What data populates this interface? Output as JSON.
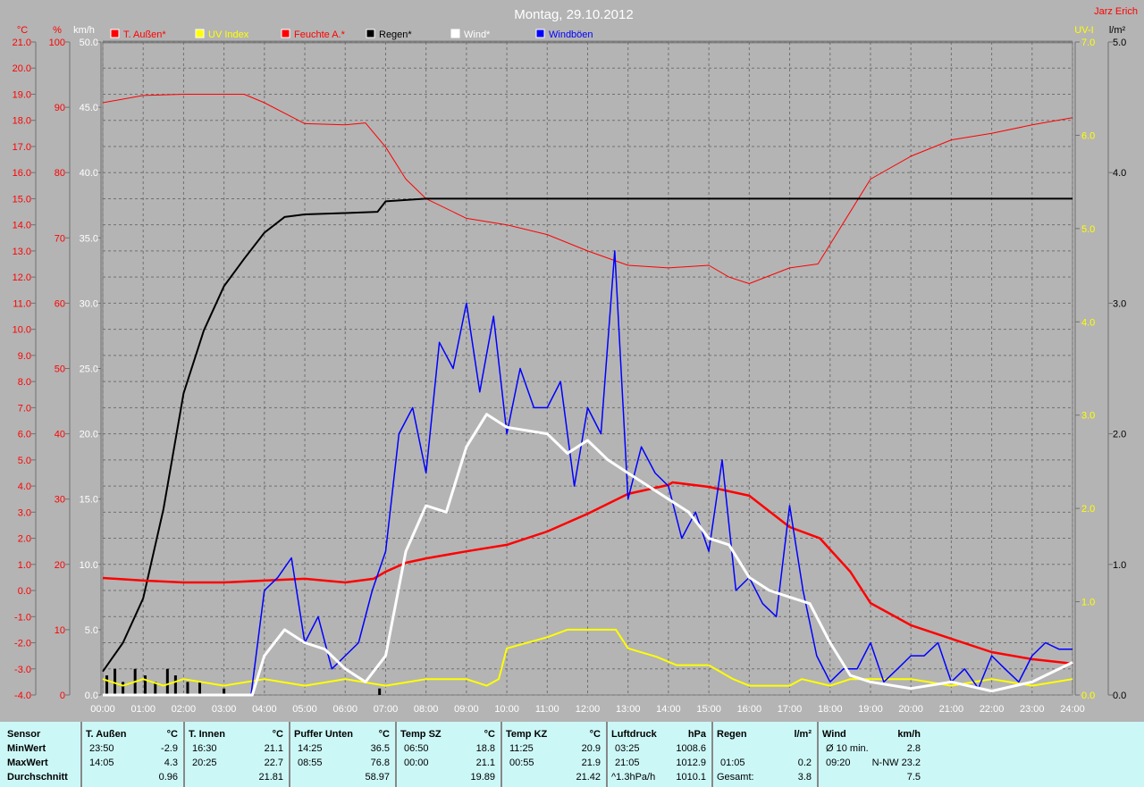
{
  "title": "Montag, 29.10.2012",
  "author": "Jarz Erich",
  "axis_units": {
    "temp": "°C",
    "humidity": "%",
    "wind": "km/h",
    "uv": "UV-I",
    "rain": "l/m²"
  },
  "legend": [
    {
      "label": "T. Außen*",
      "color": "#ff0000"
    },
    {
      "label": "UV Index",
      "color": "#ffff00"
    },
    {
      "label": "Feuchte A.*",
      "color": "#ff0000"
    },
    {
      "label": "Regen*",
      "color": "#000000"
    },
    {
      "label": "Wind*",
      "color": "#ffffff"
    },
    {
      "label": "Windböen",
      "color": "#0000ff"
    }
  ],
  "chart_data": {
    "type": "line",
    "title": "Montag, 29.10.2012",
    "x_ticks": [
      "00:00",
      "01:00",
      "02:00",
      "03:00",
      "04:00",
      "05:00",
      "06:00",
      "07:00",
      "08:00",
      "09:00",
      "10:00",
      "11:00",
      "12:00",
      "13:00",
      "14:00",
      "15:00",
      "16:00",
      "17:00",
      "18:00",
      "19:00",
      "20:00",
      "21:00",
      "22:00",
      "23:00",
      "24:00"
    ],
    "temp_ticks": [
      "21.0",
      "20.0",
      "19.0",
      "18.0",
      "17.0",
      "16.0",
      "15.0",
      "14.0",
      "13.0",
      "12.0",
      "11.0",
      "10.0",
      "9.0",
      "8.0",
      "7.0",
      "6.0",
      "5.0",
      "4.0",
      "3.0",
      "2.0",
      "1.0",
      "0.0",
      "-1.0",
      "-2.0",
      "-3.0",
      "-4.0"
    ],
    "humidity_ticks": [
      "100",
      "90",
      "80",
      "70",
      "60",
      "50",
      "40",
      "30",
      "20",
      "10",
      "0"
    ],
    "wind_ticks": [
      "50.0",
      "45.0",
      "40.0",
      "35.0",
      "30.0",
      "25.0",
      "20.0",
      "15.0",
      "10.0",
      "5.0",
      "0.0"
    ],
    "uv_ticks": [
      "7.0",
      "6.0",
      "5.0",
      "4.0",
      "3.0",
      "2.0",
      "1.0",
      "0.0"
    ],
    "rain_ticks": [
      "5.0",
      "4.0",
      "3.0",
      "2.0",
      "1.0",
      "0.0"
    ],
    "ranges": {
      "temp": [
        -4,
        21
      ],
      "humidity": [
        0,
        100
      ],
      "wind": [
        0,
        50
      ],
      "uv": [
        0,
        7
      ],
      "rain": [
        0,
        5
      ],
      "x_hours": [
        0,
        24
      ]
    },
    "grid": true,
    "series": [
      {
        "name": "Feuchte A.*",
        "axis": "humidity",
        "color": "#ff0000",
        "width": 1,
        "points": [
          [
            0,
            90.7
          ],
          [
            1,
            91.8
          ],
          [
            2,
            92
          ],
          [
            3.5,
            92
          ],
          [
            4,
            90.7
          ],
          [
            5,
            87.5
          ],
          [
            6,
            87.3
          ],
          [
            6.5,
            87.6
          ],
          [
            7,
            83.9
          ],
          [
            7.5,
            79
          ],
          [
            8,
            76
          ],
          [
            9,
            73
          ],
          [
            10,
            72
          ],
          [
            11,
            70.5
          ],
          [
            12,
            68
          ],
          [
            13,
            65.8
          ],
          [
            14,
            65.4
          ],
          [
            15,
            65.8
          ],
          [
            15.5,
            64
          ],
          [
            16,
            63
          ],
          [
            17,
            65.4
          ],
          [
            17.7,
            66
          ],
          [
            18.3,
            72
          ],
          [
            19,
            79
          ],
          [
            20,
            82.5
          ],
          [
            21,
            85
          ],
          [
            22,
            86
          ],
          [
            23,
            87.3
          ],
          [
            24,
            88.4
          ]
        ]
      },
      {
        "name": "Regen*",
        "axis": "rain",
        "color": "#000000",
        "width": 2,
        "points": [
          [
            0,
            0.18
          ],
          [
            0.5,
            0.4
          ],
          [
            1,
            0.74
          ],
          [
            1.5,
            1.42
          ],
          [
            2,
            2.31
          ],
          [
            2.5,
            2.79
          ],
          [
            3,
            3.13
          ],
          [
            3.5,
            3.34
          ],
          [
            4,
            3.54
          ],
          [
            4.5,
            3.66
          ],
          [
            5,
            3.68
          ],
          [
            6,
            3.69
          ],
          [
            6.8,
            3.7
          ],
          [
            7,
            3.78
          ],
          [
            8,
            3.8
          ],
          [
            24,
            3.8
          ]
        ]
      },
      {
        "name": "T. Außen*",
        "axis": "temp",
        "color": "#ff0000",
        "width": 2.5,
        "points": [
          [
            0,
            0.48
          ],
          [
            1,
            0.38
          ],
          [
            2,
            0.31
          ],
          [
            3,
            0.31
          ],
          [
            4,
            0.38
          ],
          [
            5,
            0.45
          ],
          [
            6,
            0.31
          ],
          [
            6.7,
            0.45
          ],
          [
            7,
            0.72
          ],
          [
            7.5,
            1.06
          ],
          [
            8,
            1.23
          ],
          [
            9,
            1.5
          ],
          [
            10,
            1.75
          ],
          [
            11,
            2.26
          ],
          [
            12,
            2.94
          ],
          [
            13,
            3.7
          ],
          [
            14,
            4.04
          ],
          [
            14.1,
            4.14
          ],
          [
            15,
            3.97
          ],
          [
            16,
            3.63
          ],
          [
            17,
            2.43
          ],
          [
            17.75,
            2.0
          ],
          [
            18.5,
            0.72
          ],
          [
            19,
            -0.48
          ],
          [
            20,
            -1.33
          ],
          [
            21,
            -1.85
          ],
          [
            22,
            -2.36
          ],
          [
            23,
            -2.63
          ],
          [
            24,
            -2.8
          ]
        ]
      },
      {
        "name": "UV Index",
        "axis": "uv",
        "color": "#ffff00",
        "width": 2,
        "points": [
          [
            0,
            0.17
          ],
          [
            0.5,
            0.1
          ],
          [
            1,
            0.17
          ],
          [
            1.5,
            0.1
          ],
          [
            2,
            0.17
          ],
          [
            3,
            0.1
          ],
          [
            4,
            0.17
          ],
          [
            5,
            0.1
          ],
          [
            6,
            0.17
          ],
          [
            7,
            0.1
          ],
          [
            8,
            0.17
          ],
          [
            9,
            0.17
          ],
          [
            9.5,
            0.1
          ],
          [
            9.8,
            0.17
          ],
          [
            10,
            0.5
          ],
          [
            11,
            0.62
          ],
          [
            11.5,
            0.7
          ],
          [
            12.7,
            0.7
          ],
          [
            13,
            0.5
          ],
          [
            13.7,
            0.41
          ],
          [
            14.2,
            0.32
          ],
          [
            15,
            0.32
          ],
          [
            15.6,
            0.17
          ],
          [
            16,
            0.1
          ],
          [
            17,
            0.1
          ],
          [
            17.3,
            0.17
          ],
          [
            18,
            0.1
          ],
          [
            18.5,
            0.17
          ],
          [
            20,
            0.17
          ],
          [
            21,
            0.1
          ],
          [
            22,
            0.17
          ],
          [
            23,
            0.1
          ],
          [
            24,
            0.17
          ]
        ]
      },
      {
        "name": "Windböen",
        "axis": "wind",
        "color": "#0000ff",
        "width": 1.5,
        "points": [
          [
            0,
            0
          ],
          [
            3.67,
            0
          ],
          [
            4,
            8
          ],
          [
            4.33,
            9
          ],
          [
            4.67,
            10.5
          ],
          [
            5,
            4
          ],
          [
            5.33,
            6
          ],
          [
            5.67,
            2
          ],
          [
            6,
            3
          ],
          [
            6.33,
            4
          ],
          [
            6.67,
            8
          ],
          [
            7,
            11
          ],
          [
            7.33,
            20
          ],
          [
            7.67,
            22
          ],
          [
            8,
            17
          ],
          [
            8.33,
            27
          ],
          [
            8.67,
            25
          ],
          [
            9,
            30
          ],
          [
            9.33,
            23.2
          ],
          [
            9.67,
            29
          ],
          [
            10,
            20
          ],
          [
            10.33,
            25
          ],
          [
            10.67,
            22
          ],
          [
            11,
            22
          ],
          [
            11.33,
            24
          ],
          [
            11.67,
            16
          ],
          [
            12,
            22
          ],
          [
            12.33,
            20
          ],
          [
            12.67,
            34
          ],
          [
            13,
            15
          ],
          [
            13.33,
            19
          ],
          [
            13.67,
            17
          ],
          [
            14,
            16
          ],
          [
            14.33,
            12
          ],
          [
            14.67,
            14
          ],
          [
            15,
            11
          ],
          [
            15.33,
            18
          ],
          [
            15.67,
            8
          ],
          [
            16,
            9
          ],
          [
            16.33,
            7
          ],
          [
            16.67,
            6
          ],
          [
            17,
            14.5
          ],
          [
            17.33,
            8
          ],
          [
            17.67,
            3
          ],
          [
            18,
            1
          ],
          [
            18.33,
            2
          ],
          [
            18.67,
            2
          ],
          [
            19,
            4
          ],
          [
            19.33,
            1
          ],
          [
            19.67,
            2
          ],
          [
            20,
            3
          ],
          [
            20.33,
            3
          ],
          [
            20.67,
            4
          ],
          [
            21,
            1
          ],
          [
            21.33,
            2
          ],
          [
            21.67,
            0.5
          ],
          [
            22,
            3
          ],
          [
            22.33,
            2
          ],
          [
            22.67,
            1
          ],
          [
            23,
            3
          ],
          [
            23.33,
            4
          ],
          [
            23.67,
            3.5
          ],
          [
            24,
            3.5
          ]
        ]
      },
      {
        "name": "Wind*",
        "axis": "wind",
        "color": "#ffffff",
        "width": 3,
        "points": [
          [
            0,
            0
          ],
          [
            3.7,
            0
          ],
          [
            4,
            3
          ],
          [
            4.5,
            5
          ],
          [
            5,
            4
          ],
          [
            5.5,
            3.5
          ],
          [
            6,
            2
          ],
          [
            6.5,
            1
          ],
          [
            7,
            3
          ],
          [
            7.5,
            11
          ],
          [
            8,
            14.5
          ],
          [
            8.5,
            14
          ],
          [
            9,
            19
          ],
          [
            9.5,
            21.5
          ],
          [
            10,
            20.5
          ],
          [
            11,
            20
          ],
          [
            11.5,
            18.5
          ],
          [
            12,
            19.5
          ],
          [
            12.5,
            18
          ],
          [
            13,
            17
          ],
          [
            13.5,
            16
          ],
          [
            14,
            15
          ],
          [
            14.5,
            14
          ],
          [
            15,
            12
          ],
          [
            15.5,
            11.5
          ],
          [
            16,
            9
          ],
          [
            16.5,
            8
          ],
          [
            17,
            7.5
          ],
          [
            17.5,
            7
          ],
          [
            18,
            4
          ],
          [
            18.5,
            1.5
          ],
          [
            19,
            1
          ],
          [
            20,
            0.5
          ],
          [
            21,
            1
          ],
          [
            22,
            0.3
          ],
          [
            23,
            1
          ],
          [
            24,
            2.5
          ]
        ]
      }
    ],
    "rain_bars": [
      [
        0.1,
        0.15
      ],
      [
        0.3,
        0.2
      ],
      [
        0.5,
        0.1
      ],
      [
        0.8,
        0.2
      ],
      [
        1.05,
        0.15
      ],
      [
        1.3,
        0.1
      ],
      [
        1.6,
        0.2
      ],
      [
        1.8,
        0.15
      ],
      [
        2.1,
        0.1
      ],
      [
        2.4,
        0.1
      ],
      [
        3,
        0.05
      ],
      [
        6.85,
        0.05
      ]
    ]
  },
  "table": {
    "row_labels": [
      "Sensor",
      "MinWert",
      "MaxWert",
      "Durchschnitt"
    ],
    "groups": [
      {
        "name": "T. Außen",
        "unit": "°C",
        "min_time": "23:50",
        "min": "-2.9",
        "max_time": "14:05",
        "max": "4.3",
        "avg_label": "",
        "avg": "0.96"
      },
      {
        "name": "T. Innen",
        "unit": "°C",
        "min_time": "16:30",
        "min": "21.1",
        "max_time": "20:25",
        "max": "22.7",
        "avg_label": "",
        "avg": "21.81"
      },
      {
        "name": "Puffer Unten",
        "unit": "°C",
        "min_time": "14:25",
        "min": "36.5",
        "max_time": "08:55",
        "max": "76.8",
        "avg_label": "",
        "avg": "58.97"
      },
      {
        "name": "Temp SZ",
        "unit": "°C",
        "min_time": "06:50",
        "min": "18.8",
        "max_time": "00:00",
        "max": "21.1",
        "avg_label": "",
        "avg": "19.89"
      },
      {
        "name": "Temp KZ",
        "unit": "°C",
        "min_time": "11:25",
        "min": "20.9",
        "max_time": "00:55",
        "max": "21.9",
        "avg_label": "",
        "avg": "21.42"
      },
      {
        "name": "Luftdruck",
        "unit": "hPa",
        "min_time": "03:25",
        "min": "1008.6",
        "max_time": "21:05",
        "max": "1012.9",
        "avg_label": "^1.3hPa/h",
        "avg": "1010.1"
      },
      {
        "name": "Regen",
        "unit": "l/m²",
        "min_time": "",
        "min": "",
        "max_time": "01:05",
        "max": "0.2",
        "avg_label": "Gesamt:",
        "avg": "3.8"
      },
      {
        "name": "Wind",
        "unit": "km/h",
        "min_time": "Ø 10 min.",
        "min": "2.8",
        "max_time": "09:20",
        "max": "N-NW 23.2",
        "avg_label": "",
        "avg": "7.5"
      }
    ]
  }
}
